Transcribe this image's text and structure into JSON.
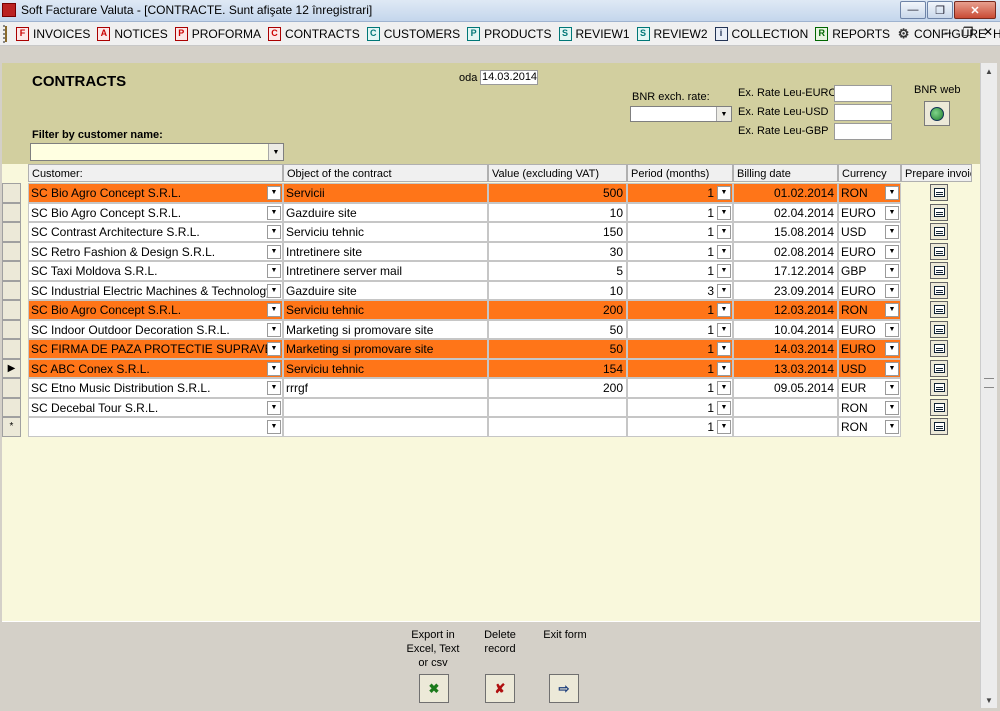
{
  "window": {
    "title": "Soft Facturare Valuta - [CONTRACTE. Sunt afişate 12 înregistrari]"
  },
  "menu": [
    {
      "label": "INVOICES",
      "icon_letter": "F",
      "color": "red"
    },
    {
      "label": "NOTICES",
      "icon_letter": "A",
      "color": "red"
    },
    {
      "label": "PROFORMA",
      "icon_letter": "P",
      "color": "red"
    },
    {
      "label": "CONTRACTS",
      "icon_letter": "C",
      "color": "red"
    },
    {
      "label": "CUSTOMERS",
      "icon_letter": "C",
      "color": "teal"
    },
    {
      "label": "PRODUCTS",
      "icon_letter": "P",
      "color": "teal"
    },
    {
      "label": "REVIEW1",
      "icon_letter": "S",
      "color": "teal"
    },
    {
      "label": "REVIEW2",
      "icon_letter": "S",
      "color": "teal"
    },
    {
      "label": "COLLECTION",
      "icon_letter": "i",
      "color": "blue"
    },
    {
      "label": "REPORTS",
      "icon_letter": "R",
      "color": "green"
    },
    {
      "label": "CONFIGURE",
      "icon_letter": "⚙",
      "color": "gear"
    },
    {
      "label": "HELP",
      "icon_letter": "",
      "color": "none"
    }
  ],
  "header": {
    "title": "CONTRACTS",
    "today_label": "oda",
    "today_value": "14.03.2014",
    "bnr_label": "BNR exch. rate:",
    "bnr_value": "",
    "rates": [
      {
        "label": "Ex. Rate Leu-EURO",
        "value": ""
      },
      {
        "label": "Ex. Rate Leu-USD",
        "value": ""
      },
      {
        "label": "Ex. Rate Leu-GBP",
        "value": ""
      }
    ],
    "bnr_web_label": "BNR web",
    "filter_label": "Filter by customer name:",
    "filter_value": ""
  },
  "grid": {
    "columns": [
      "Customer:",
      "Object of the contract",
      "Value (excluding VAT)",
      "Period (months)",
      "Billing date",
      "Currency",
      "Prepare invoice"
    ],
    "rows": [
      {
        "customer": "SC Bio Agro Concept S.R.L.",
        "object": "Servicii",
        "value": "500",
        "period": "1",
        "billing_date": "01.02.2014",
        "currency": "RON",
        "highlight": true,
        "current": false
      },
      {
        "customer": "SC Bio Agro Concept S.R.L.",
        "object": "Gazduire site",
        "value": "10",
        "period": "1",
        "billing_date": "02.04.2014",
        "currency": "EURO",
        "highlight": false,
        "current": false
      },
      {
        "customer": "SC Contrast Architecture S.R.L.",
        "object": "Serviciu tehnic",
        "value": "150",
        "period": "1",
        "billing_date": "15.08.2014",
        "currency": "USD",
        "highlight": false,
        "current": false
      },
      {
        "customer": "SC Retro Fashion & Design S.R.L.",
        "object": "Intretinere site",
        "value": "30",
        "period": "1",
        "billing_date": "02.08.2014",
        "currency": "EURO",
        "highlight": false,
        "current": false
      },
      {
        "customer": "SC Taxi Moldova S.R.L.",
        "object": "Intretinere server mail",
        "value": "5",
        "period": "1",
        "billing_date": "17.12.2014",
        "currency": "GBP",
        "highlight": false,
        "current": false
      },
      {
        "customer": "SC Industrial Electric Machines & Technology",
        "object": "Gazduire site",
        "value": "10",
        "period": "3",
        "billing_date": "23.09.2014",
        "currency": "EURO",
        "highlight": false,
        "current": false
      },
      {
        "customer": "SC Bio Agro Concept S.R.L.",
        "object": "Serviciu tehnic",
        "value": "200",
        "period": "1",
        "billing_date": "12.03.2014",
        "currency": "RON",
        "highlight": true,
        "current": false
      },
      {
        "customer": "SC Indoor Outdoor Decoration S.R.L.",
        "object": "Marketing si promovare site",
        "value": "50",
        "period": "1",
        "billing_date": "10.04.2014",
        "currency": "EURO",
        "highlight": false,
        "current": false
      },
      {
        "customer": "SC FIRMA DE PAZA PROTECTIE SUPRAVEGH",
        "object": "Marketing si promovare site",
        "value": "50",
        "period": "1",
        "billing_date": "14.03.2014",
        "currency": "EURO",
        "highlight": true,
        "current": false
      },
      {
        "customer": "SC ABC Conex S.R.L.",
        "object": "Serviciu tehnic",
        "value": "154",
        "period": "1",
        "billing_date": "13.03.2014",
        "currency": "USD",
        "highlight": true,
        "current": true
      },
      {
        "customer": "SC Etno Music Distribution S.R.L.",
        "object": "rrrgf",
        "value": "200",
        "period": "1",
        "billing_date": "09.05.2014",
        "currency": "EUR",
        "highlight": false,
        "current": false
      },
      {
        "customer": "SC Decebal Tour S.R.L.",
        "object": "",
        "value": "",
        "period": "1",
        "billing_date": "",
        "currency": "RON",
        "highlight": false,
        "current": false
      },
      {
        "customer": "",
        "object": "",
        "value": "",
        "period": "1",
        "billing_date": "",
        "currency": "RON",
        "highlight": false,
        "current": false,
        "new_record": true
      }
    ],
    "current_row_marker": "▶",
    "new_row_marker": "*"
  },
  "footer": {
    "export_label": "Export in Excel, Text or csv",
    "delete_label": "Delete record",
    "exit_label": "Exit form"
  },
  "colors": {
    "highlight": "#ff7518",
    "header_band": "#d2cf9f",
    "detail_bg": "#f9f8dc"
  }
}
